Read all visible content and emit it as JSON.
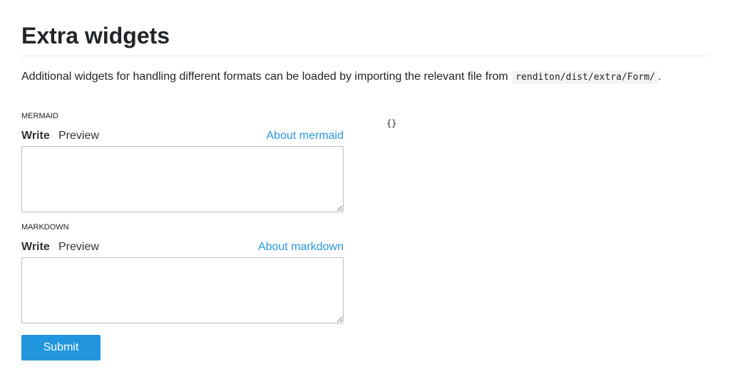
{
  "page": {
    "title": "Extra widgets",
    "intro_text": "Additional widgets for handling different formats can be loaded by importing the relevant file from",
    "intro_code": "renditon/dist/extra/Form/",
    "intro_suffix": "."
  },
  "fields": [
    {
      "label": "MERMAID",
      "write_tab": "Write",
      "preview_tab": "Preview",
      "about_link": "About mermaid",
      "value": ""
    },
    {
      "label": "MARKDOWN",
      "write_tab": "Write",
      "preview_tab": "Preview",
      "about_link": "About markdown",
      "value": ""
    }
  ],
  "submit_label": "Submit",
  "output_json": "{}",
  "colors": {
    "accent": "#2196de",
    "link": "#2a96de",
    "text": "#212529"
  }
}
